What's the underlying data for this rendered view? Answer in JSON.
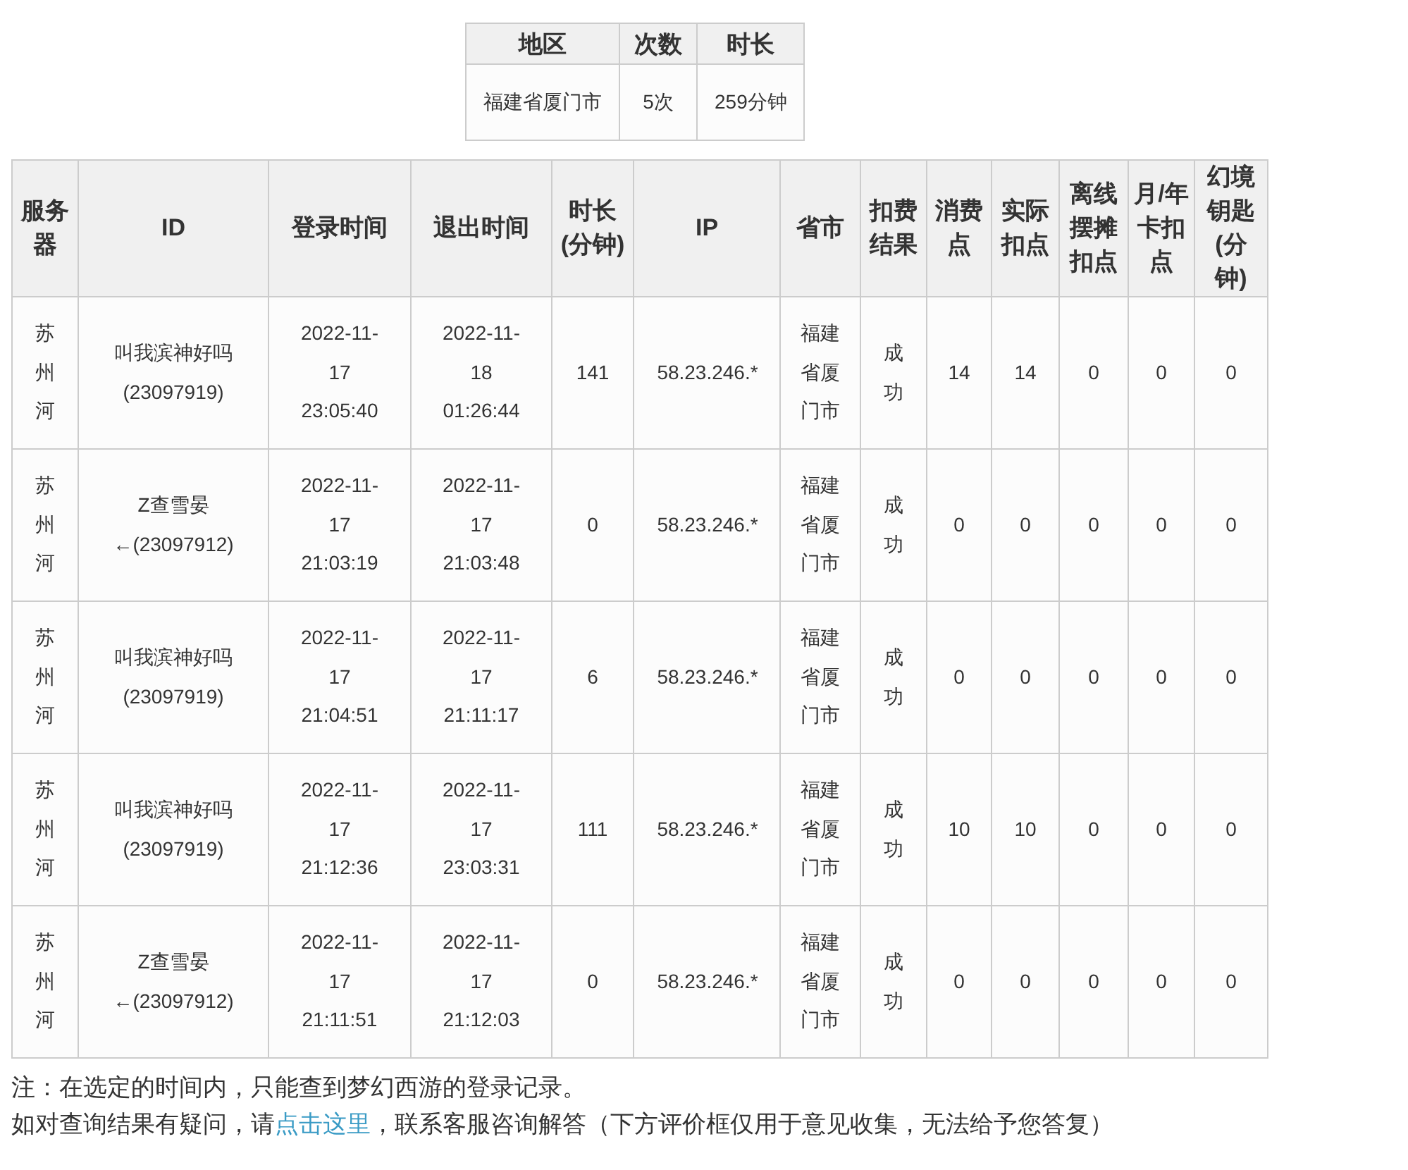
{
  "summary": {
    "columns": [
      "地区",
      "次数",
      "时长"
    ],
    "rows": [
      [
        "福建省厦门市",
        "5次",
        "259分钟"
      ]
    ]
  },
  "records": {
    "columns": [
      "服务器",
      "ID",
      "登录时间",
      "退出时间",
      "时长(分钟)",
      "IP",
      "省市",
      "扣费结果",
      "消费点",
      "实际扣点",
      "离线摆摊扣点",
      "月/年卡扣点",
      "幻境钥匙(分钟)"
    ],
    "rows": [
      [
        "苏州河",
        "叫我滨神好吗(23097919)",
        "2022-11-17 23:05:40",
        "2022-11-18 01:26:44",
        "141",
        "58.23.246.*",
        "福建省厦门市",
        "成功",
        "14",
        "14",
        "0",
        "0",
        "0"
      ],
      [
        "苏州河",
        "Z查雪晏←(23097912)",
        "2022-11-17 21:03:19",
        "2022-11-17 21:03:48",
        "0",
        "58.23.246.*",
        "福建省厦门市",
        "成功",
        "0",
        "0",
        "0",
        "0",
        "0"
      ],
      [
        "苏州河",
        "叫我滨神好吗(23097919)",
        "2022-11-17 21:04:51",
        "2022-11-17 21:11:17",
        "6",
        "58.23.246.*",
        "福建省厦门市",
        "成功",
        "0",
        "0",
        "0",
        "0",
        "0"
      ],
      [
        "苏州河",
        "叫我滨神好吗(23097919)",
        "2022-11-17 21:12:36",
        "2022-11-17 23:03:31",
        "111",
        "58.23.246.*",
        "福建省厦门市",
        "成功",
        "10",
        "10",
        "0",
        "0",
        "0"
      ],
      [
        "苏州河",
        "Z查雪晏←(23097912)",
        "2022-11-17 21:11:51",
        "2022-11-17 21:12:03",
        "0",
        "58.23.246.*",
        "福建省厦门市",
        "成功",
        "0",
        "0",
        "0",
        "0",
        "0"
      ]
    ]
  },
  "notes": [
    {
      "text": "注：在选定的时间内，只能查到梦幻西游的登录记录。"
    },
    {
      "before": "如对查询结果有疑问，请",
      "link": "点击这里",
      "after": "，联系客服咨询解答（下方评价框仅用于意见收集，无法给予您答复）"
    }
  ]
}
